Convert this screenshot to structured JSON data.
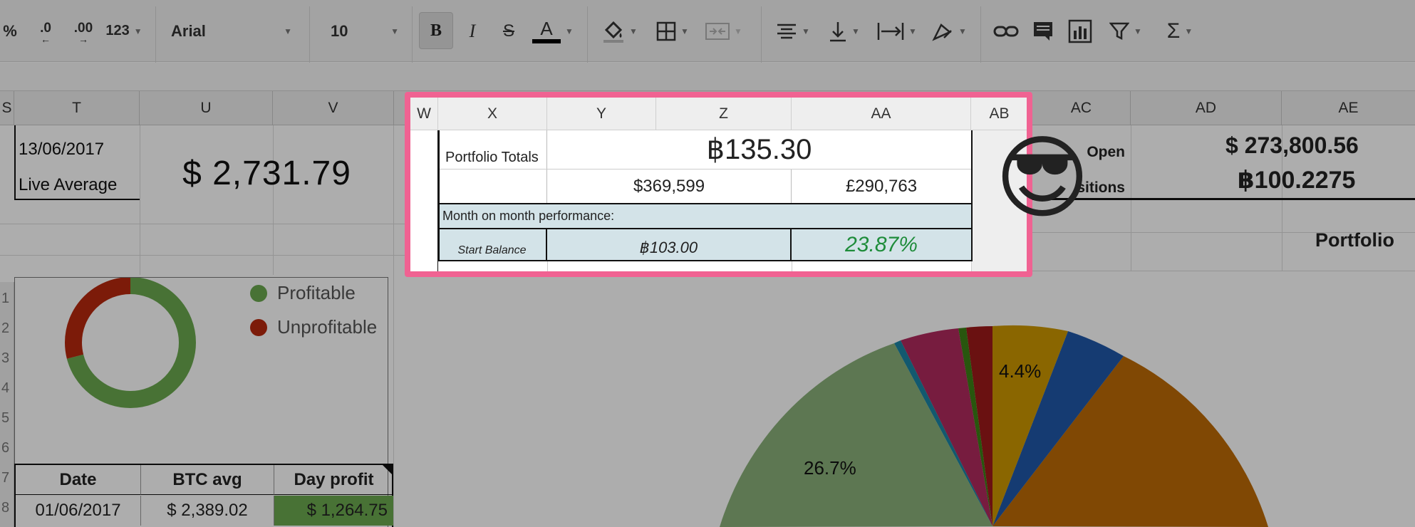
{
  "toolbar": {
    "percent": "%",
    "dec_decrease": ".0",
    "dec_increase": ".00",
    "number_format": "123",
    "font_family": "Arial",
    "font_size": "10",
    "bold": "B",
    "italic": "I",
    "strikethrough": "S",
    "text_color": "A"
  },
  "columns": {
    "left": [
      "S",
      "T",
      "U",
      "V"
    ],
    "highlight": [
      "W",
      "X",
      "Y",
      "Z",
      "AA",
      "AB"
    ],
    "right": [
      "AC",
      "AD",
      "AE"
    ]
  },
  "row_numbers": [
    "1",
    "2",
    "3",
    "4",
    "5",
    "6",
    "7",
    "8"
  ],
  "left_cells": {
    "date": "13/06/2017",
    "live_average_label": "Live Average",
    "live_average_value": "$ 2,731.79"
  },
  "donut_legend": [
    {
      "label": "Profitable",
      "color": "#6aa84f"
    },
    {
      "label": "Unprofitable",
      "color": "#b7280e"
    }
  ],
  "donut_data": {
    "profitable_fraction": 0.71
  },
  "highlight_table": {
    "portfolio_totals_label": "Portfolio Totals",
    "btc_total": "฿135.30",
    "usd_total": "$369,599",
    "gbp_total": "£290,763",
    "mom_label": "Month on month performance:",
    "start_balance_label": "Start Balance",
    "start_balance_value": "฿103.00",
    "performance": "23.87%"
  },
  "right_cells": {
    "open_label": "Open",
    "open_value": "$ 273,800.56",
    "positions_label": "sitions",
    "positions_value": "฿100.2275",
    "portfolio_label": "Portfolio"
  },
  "pie_labels": {
    "large": "26.7%",
    "small": "4.4%"
  },
  "bottom_table": {
    "headers": [
      "Date",
      "BTC avg",
      "Day profit"
    ],
    "row": [
      "01/06/2017",
      "$ 2,389.02",
      "$ 1,264.75"
    ]
  },
  "emoji": "😎",
  "colors": {
    "highlight_border": "#f06292",
    "teal": "#d3e3e8",
    "green_text": "#1e8c3a"
  }
}
